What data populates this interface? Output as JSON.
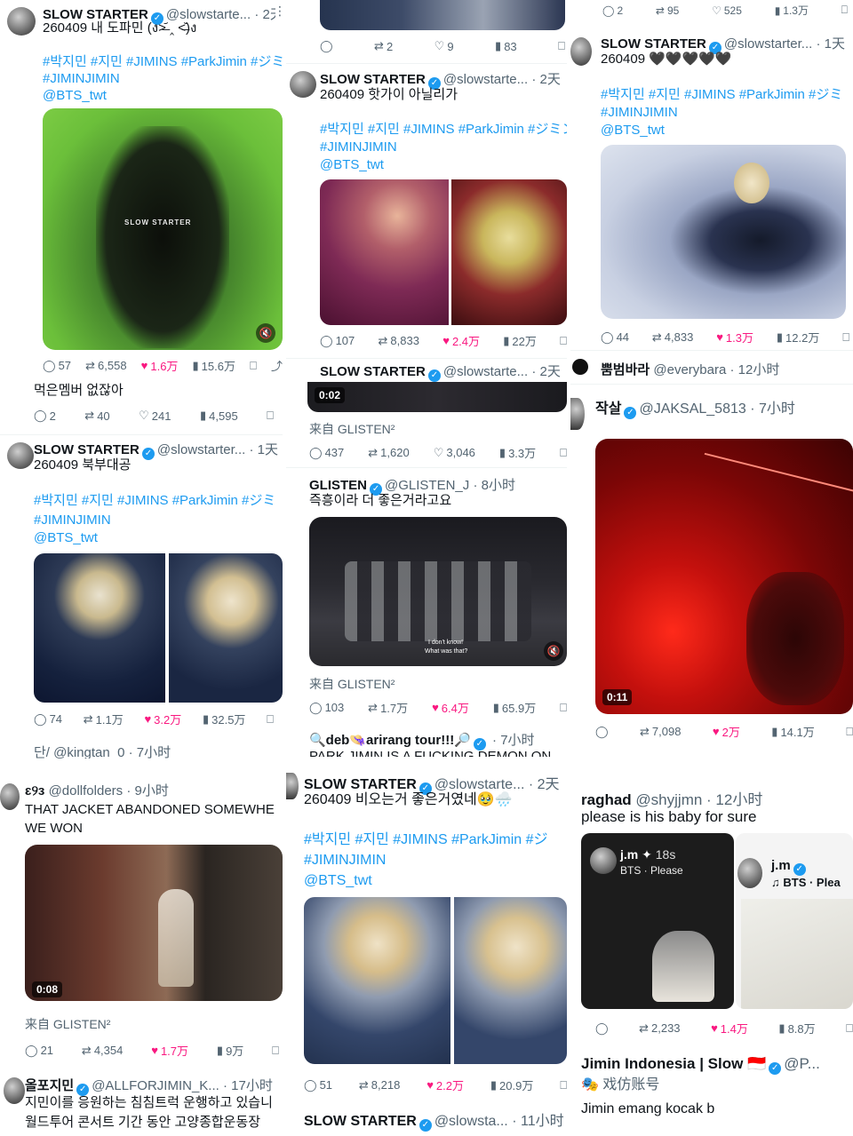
{
  "col1": {
    "t1": {
      "name": "SLOW STARTER",
      "handle": "@slowstarte...",
      "time": "· 2天",
      "text": "260409 내 도파민 (ง˃̶᷄ ‸ ˂̶᷅)ง",
      "tags_line1": "#박지민 #지민 #JIMINS #ParkJimin #ジミン",
      "tags_line2": "#JIMINJIMIN",
      "mention": "@BTS_twt",
      "overlay": "SLOW STARTER",
      "stats": {
        "reply": "57",
        "retweet": "6,558",
        "like": "1.6万",
        "views": "15.6万"
      }
    },
    "t2": {
      "text": "먹은멤버 없잖아",
      "stats": {
        "reply": "2",
        "retweet": "40",
        "like": "241",
        "views": "4,595"
      }
    },
    "t3": {
      "name": "SLOW STARTER",
      "handle": "@slowstarter...",
      "time": "· 1天",
      "text": "260409 북부대공",
      "tags_line1": "#박지민 #지민 #JIMINS #ParkJimin #ジミ",
      "tags_line2": "#JIMINJIMIN",
      "mention": "@BTS_twt",
      "stats": {
        "reply": "74",
        "retweet": "1.1万",
        "like": "3.2万",
        "views": "32.5万"
      }
    },
    "t4": {
      "partial": "단/ @kingtan_0 · 7小时"
    },
    "t5": {
      "name": "ɛ୨ɜ",
      "handle": "@dollfolders",
      "time": "· 9小时",
      "text1": "THAT JACKET ABANDONED SOMEWHE",
      "text2": "WE WON",
      "video_time": "0:08",
      "from": "来自 GLISTEN²",
      "stats": {
        "reply": "21",
        "retweet": "4,354",
        "like": "1.7万",
        "views": "9万"
      }
    },
    "t6": {
      "name": "올포지민",
      "handle": "@ALLFORJIMIN_K...",
      "time": "· 17小时",
      "text1": "지민이를 응원하는 침침트럭 운행하고 있습니",
      "text2": "월드투어 콘서트 기간 동안 고양종합운동장 "
    }
  },
  "col2": {
    "t0": {
      "stats": {
        "reply": "",
        "retweet": "2",
        "like": "9",
        "views": "83"
      }
    },
    "t1": {
      "name": "SLOW STARTER",
      "handle": "@slowstarte...",
      "time": "· 2天",
      "text": "260409 핫가이 아닐리가",
      "tags_line1": "#박지민 #지민 #JIMINS #ParkJimin #ジミン",
      "tags_line2": "#JIMINJIMIN",
      "mention": "@BTS_twt",
      "stats": {
        "reply": "107",
        "retweet": "8,833",
        "like": "2.4万",
        "views": "22万"
      }
    },
    "t2": {
      "name": "SLOW STARTER",
      "handle": "@slowstarte...",
      "time": "· 2天",
      "video_time": "0:02",
      "from": "来自 GLISTEN²",
      "stats": {
        "reply": "437",
        "retweet": "1,620",
        "like": "3,046",
        "views": "3.3万"
      }
    },
    "t3": {
      "name": "GLISTEN",
      "handle": "@GLISTEN_J",
      "time": "· 8小时",
      "text": "즉흥이라 더 좋은거라고요",
      "subtitle1": "I don't know!",
      "subtitle2": "What was that?",
      "from": "来自 GLISTEN²",
      "stats": {
        "reply": "103",
        "retweet": "1.7万",
        "like": "6.4万",
        "views": "65.9万"
      }
    },
    "t4": {
      "name": "🔍deb👒arirang tour!!!🔎",
      "time": "· 7小时",
      "partial": "PARK JIMIN IS A FUCKING DEMON ON"
    },
    "t5": {
      "name": "SLOW STARTER",
      "handle": "@slowstarte...",
      "time": "· 2天",
      "text": "260409 비오는거 좋은거였네🥹🌧️",
      "tags_line1": "#박지민 #지민 #JIMINS #ParkJimin #ジ",
      "tags_line2": "#JIMINJIMIN",
      "mention": "@BTS_twt",
      "stats": {
        "reply": "51",
        "retweet": "8,218",
        "like": "2.2万",
        "views": "20.9万"
      }
    },
    "t6": {
      "name": "SLOW STARTER",
      "handle": "@slowsta...",
      "time": "· 11小时"
    }
  },
  "col3": {
    "t0": {
      "stats": {
        "reply": "2",
        "retweet": "95",
        "like": "525",
        "views": "1.3万"
      }
    },
    "t1": {
      "name": "SLOW STARTER",
      "handle": "@slowstarter...",
      "time": "· 1天",
      "text": "260409 🖤🖤🖤🖤🖤",
      "tags_line1": "#박지민 #지민 #JIMINS #ParkJimin #ジミ",
      "tags_line2": "#JIMINJIMIN",
      "mention": "@BTS_twt",
      "stats": {
        "reply": "44",
        "retweet": "4,833",
        "like": "1.3万",
        "views": "12.2万"
      }
    },
    "t2": {
      "name": "뿜범바라",
      "handle": "@everybara",
      "time": "· 12小时"
    },
    "t3": {
      "name": "작살",
      "handle": "@JAKSAL_5813",
      "time": "· 7小时",
      "video_time": "0:11",
      "stats": {
        "reply": "",
        "retweet": "7,098",
        "like": "2万",
        "views": "14.1万"
      }
    },
    "t4": {
      "name": "raghad",
      "handle": "@shyjjmn",
      "time": "· 12小时",
      "text": "please is his baby for sure",
      "story_name": "j.m",
      "story_time": "18s",
      "story_song": "BTS · Please",
      "profile_name": "j.m",
      "profile_song": "BTS · Plea",
      "stats": {
        "reply": "",
        "retweet": "2,233",
        "like": "1.4万",
        "views": "8.8万"
      }
    },
    "t5": {
      "name": "Jimin Indonesia | Slow",
      "handle": "@P...",
      "label": "戏仿账号",
      "text": "Jimin emang kocak b"
    }
  },
  "colors": {
    "accent": "#1d9bf0",
    "like": "#f91880",
    "text": "#0f1419",
    "muted": "#536471"
  }
}
